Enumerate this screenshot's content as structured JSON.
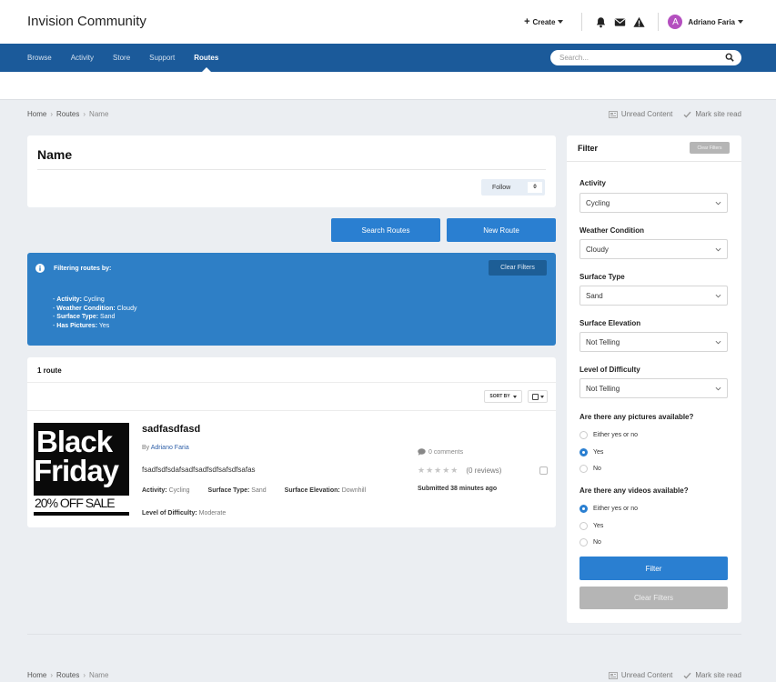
{
  "header": {
    "site_title": "Invision Community",
    "create_label": "Create",
    "user_initial": "A",
    "user_name": "Adriano Faria"
  },
  "nav": {
    "items": [
      "Browse",
      "Activity",
      "Store",
      "Support",
      "Routes"
    ],
    "active": "Routes",
    "search_placeholder": "Search..."
  },
  "breadcrumb": [
    "Home",
    "Routes",
    "Name"
  ],
  "site_links": {
    "unread": "Unread Content",
    "mark_read": "Mark site read"
  },
  "page": {
    "title": "Name",
    "follow_label": "Follow",
    "follow_count": "0"
  },
  "buttons": {
    "search_routes": "Search Routes",
    "new_route": "New Route"
  },
  "filter_banner": {
    "heading": "Filtering routes by:",
    "clear": "Clear Filters",
    "items": [
      {
        "label": "Activity",
        "value": "Cycling"
      },
      {
        "label": "Weather Condition",
        "value": "Cloudy"
      },
      {
        "label": "Surface Type",
        "value": "Sand"
      },
      {
        "label": "Has Pictures",
        "value": "Yes"
      }
    ]
  },
  "results": {
    "count": "1 route",
    "sort_by": "SORT BY",
    "item": {
      "title": "sadfasdfasd",
      "by": "By",
      "author": "Adriano Faria",
      "description": "fsadfsdfsdafsadfsadfsdfsafsdfsafas",
      "activity_label": "Activity",
      "activity": "Cycling",
      "surface_type_label": "Surface Type",
      "surface_type": "Sand",
      "surface_elevation_label": "Surface Elevation",
      "surface_elevation": "Downhill",
      "difficulty_label": "Level of Difficulty",
      "difficulty": "Moderate",
      "comments": "0 comments",
      "stars": "★★★★★",
      "reviews": "(0 reviews)",
      "submitted": "Submitted 38 minutes ago",
      "thumbnail": {
        "line1": "Black",
        "line2": "Friday",
        "line3": "20% OFF SALE"
      }
    }
  },
  "sidebar": {
    "title": "Filter",
    "clear_top": "Clear Filters",
    "activity_label": "Activity",
    "activity_value": "Cycling",
    "weather_label": "Weather Condition",
    "weather_value": "Cloudy",
    "surface_type_label": "Surface Type",
    "surface_type_value": "Sand",
    "surface_elevation_label": "Surface Elevation",
    "surface_elevation_value": "Not Telling",
    "difficulty_label": "Level of Difficulty",
    "difficulty_value": "Not Telling",
    "pictures_label": "Are there any pictures available?",
    "pictures_options": [
      "Either yes or no",
      "Yes",
      "No"
    ],
    "pictures_selected": "Yes",
    "videos_label": "Are there any videos available?",
    "videos_options": [
      "Either yes or no",
      "Yes",
      "No"
    ],
    "videos_selected": "Either yes or no",
    "filter_button": "Filter",
    "clear_button": "Clear Filters"
  },
  "colors": {
    "brand": "#1b5a9a",
    "accent": "#2a7fd1",
    "banner": "#2e7fc6"
  }
}
